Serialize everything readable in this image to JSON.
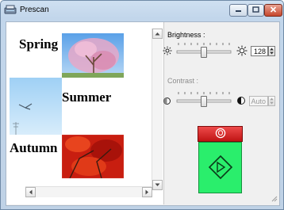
{
  "window": {
    "title": "Prescan"
  },
  "preview": {
    "words": {
      "spring": "Spring",
      "summer": "Summer",
      "autumn": "Autumn"
    }
  },
  "brightness": {
    "label": "Brightness :",
    "value": "128",
    "level": 0.5
  },
  "contrast": {
    "label": "Contrast :",
    "value": "Auto",
    "level": 0.5
  },
  "colors": {
    "stop_button": "#d41c1c",
    "start_button": "#2aee6c",
    "window_frame": "#c2d6eb"
  },
  "icons": {
    "app": "scanner-icon",
    "minimize": "minimize-icon",
    "maximize": "maximize-icon",
    "close": "close-icon",
    "brightness_low": "sun-small-icon",
    "brightness_high": "sun-large-icon",
    "contrast_low": "contrast-low-icon",
    "contrast_high": "contrast-high-icon",
    "stop": "stop-icon",
    "start": "start-diamond-icon"
  }
}
